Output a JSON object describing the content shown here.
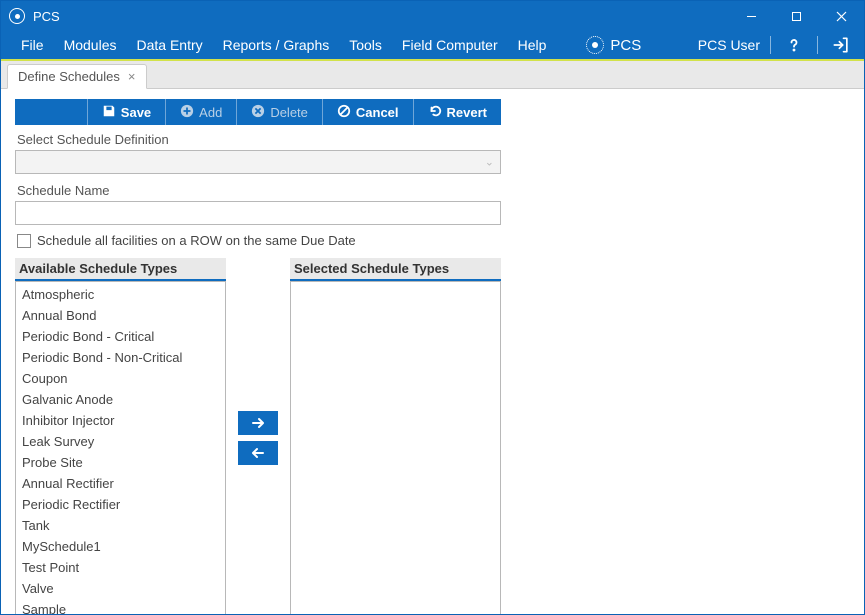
{
  "titlebar": {
    "app_name": "PCS"
  },
  "menu": {
    "items": [
      "File",
      "Modules",
      "Data Entry",
      "Reports / Graphs",
      "Tools",
      "Field Computer",
      "Help"
    ],
    "brand": "PCS",
    "user": "PCS User"
  },
  "tabs": [
    {
      "label": "Define Schedules",
      "closable": true
    }
  ],
  "toolbar": {
    "save": {
      "label": "Save",
      "enabled": true
    },
    "add": {
      "label": "Add",
      "enabled": false
    },
    "delete": {
      "label": "Delete",
      "enabled": false
    },
    "cancel": {
      "label": "Cancel",
      "enabled": true
    },
    "revert": {
      "label": "Revert",
      "enabled": true
    }
  },
  "form": {
    "select_label": "Select Schedule Definition",
    "select_value": "",
    "name_label": "Schedule Name",
    "name_value": "",
    "checkbox_label": "Schedule all facilities on a ROW on the same Due Date",
    "checkbox_checked": false
  },
  "lists": {
    "available_header": "Available Schedule Types",
    "selected_header": "Selected Schedule Types",
    "available": [
      "Atmospheric",
      "Annual Bond",
      "Periodic Bond - Critical",
      "Periodic Bond - Non-Critical",
      "Coupon",
      "Galvanic Anode",
      "Inhibitor Injector",
      "Leak Survey",
      "Probe Site",
      "Annual Rectifier",
      "Periodic Rectifier",
      "Tank",
      "MySchedule1",
      "Test Point",
      "Valve",
      "Sample"
    ],
    "selected": []
  }
}
